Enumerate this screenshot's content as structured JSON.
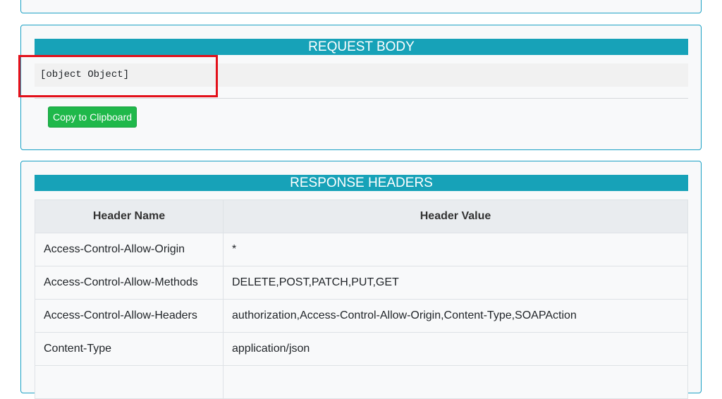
{
  "request_body": {
    "title": "REQUEST BODY",
    "content": "[object Object]",
    "copy_label": "Copy to Clipboard"
  },
  "response_headers": {
    "title": "RESPONSE HEADERS",
    "columns": [
      "Header Name",
      "Header Value"
    ],
    "rows": [
      {
        "name": "Access-Control-Allow-Origin",
        "value": "*"
      },
      {
        "name": "Access-Control-Allow-Methods",
        "value": "DELETE,POST,PATCH,PUT,GET"
      },
      {
        "name": "Access-Control-Allow-Headers",
        "value": "authorization,Access-Control-Allow-Origin,Content-Type,SOAPAction"
      },
      {
        "name": "Content-Type",
        "value": "application/json"
      },
      {
        "name": "",
        "value": ""
      }
    ]
  },
  "colors": {
    "section_header": "#17a2b8",
    "panel_border": "#1aa0c4",
    "copy_button": "#1fb84a",
    "highlight": "#e3101a"
  }
}
